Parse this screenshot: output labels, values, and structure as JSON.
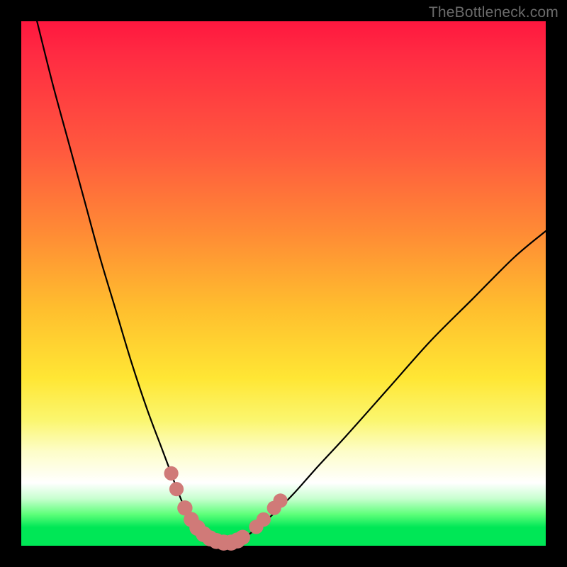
{
  "watermark": "TheBottleneck.com",
  "chart_data": {
    "type": "line",
    "title": "",
    "xlabel": "",
    "ylabel": "",
    "xlim": [
      0,
      100
    ],
    "ylim": [
      0,
      100
    ],
    "series": [
      {
        "name": "bottleneck-curve",
        "x": [
          3,
          6,
          9,
          12,
          15,
          18,
          21,
          24,
          27,
          28.5,
          30,
          31.5,
          33,
          34.5,
          36,
          38,
          40,
          42,
          44,
          48,
          52,
          56,
          62,
          70,
          78,
          86,
          94,
          100
        ],
        "y": [
          100,
          88,
          77,
          66,
          55,
          45,
          35,
          26,
          18,
          14,
          10,
          6.5,
          4,
          2.3,
          1.2,
          0.6,
          0.6,
          1.3,
          2.6,
          6,
          10,
          14.5,
          21,
          30,
          39,
          47,
          55,
          60
        ]
      }
    ],
    "markers": {
      "name": "highlight-dots",
      "color": "#d07a78",
      "points": [
        {
          "x": 28.6,
          "y": 13.8,
          "r": 1.6
        },
        {
          "x": 29.6,
          "y": 10.8,
          "r": 1.6
        },
        {
          "x": 31.2,
          "y": 7.2,
          "r": 1.7
        },
        {
          "x": 32.4,
          "y": 5.0,
          "r": 1.7
        },
        {
          "x": 33.6,
          "y": 3.4,
          "r": 1.8
        },
        {
          "x": 34.8,
          "y": 2.2,
          "r": 1.8
        },
        {
          "x": 36.0,
          "y": 1.4,
          "r": 1.8
        },
        {
          "x": 37.2,
          "y": 0.9,
          "r": 1.8
        },
        {
          "x": 38.6,
          "y": 0.6,
          "r": 1.8
        },
        {
          "x": 40.0,
          "y": 0.6,
          "r": 1.8
        },
        {
          "x": 41.2,
          "y": 1.0,
          "r": 1.8
        },
        {
          "x": 42.2,
          "y": 1.6,
          "r": 1.7
        },
        {
          "x": 44.8,
          "y": 3.6,
          "r": 1.6
        },
        {
          "x": 46.2,
          "y": 5.0,
          "r": 1.6
        },
        {
          "x": 48.2,
          "y": 7.2,
          "r": 1.6
        },
        {
          "x": 49.4,
          "y": 8.6,
          "r": 1.6
        }
      ]
    }
  }
}
